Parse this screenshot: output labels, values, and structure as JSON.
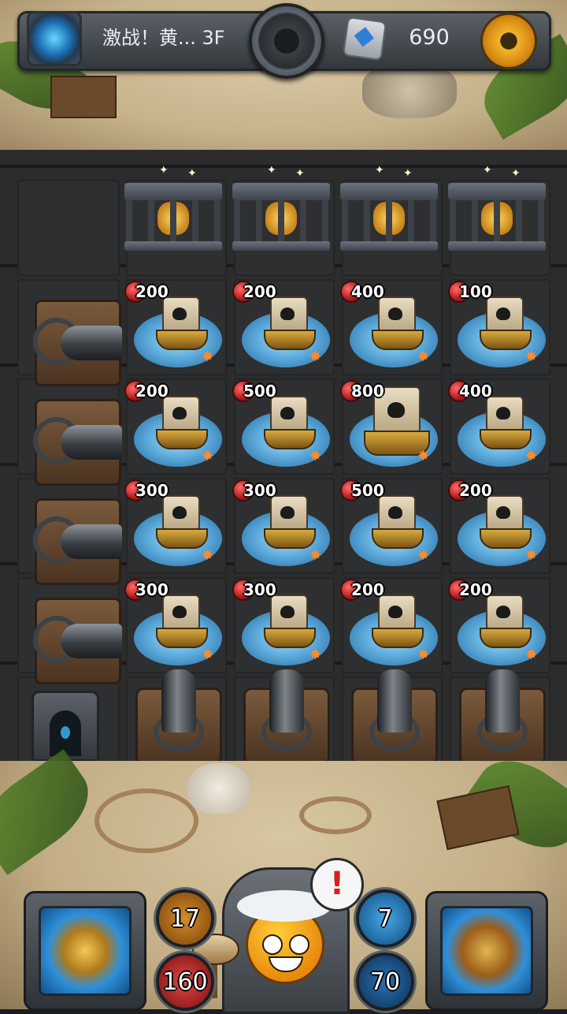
{
  "header": {
    "stage_title": "激战！黄... 3F",
    "gem_count": "690",
    "icons": [
      "portal-icon",
      "bomb-dial-icon",
      "gem-icon",
      "gear-icon"
    ]
  },
  "treasure_cages": [
    {
      "item": "gold-coins"
    },
    {
      "item": "gold-nuggets"
    },
    {
      "item": "gold-pot"
    },
    {
      "item": "jewelry"
    }
  ],
  "enemies": [
    [
      {
        "hp": "200"
      },
      {
        "hp": "200"
      },
      {
        "hp": "400"
      },
      {
        "hp": "100"
      }
    ],
    [
      {
        "hp": "200"
      },
      {
        "hp": "500"
      },
      {
        "hp": "800",
        "big": true
      },
      {
        "hp": "400"
      }
    ],
    [
      {
        "hp": "300"
      },
      {
        "hp": "300"
      },
      {
        "hp": "500"
      },
      {
        "hp": "200"
      }
    ],
    [
      {
        "hp": "300"
      },
      {
        "hp": "300"
      },
      {
        "hp": "200"
      },
      {
        "hp": "200"
      }
    ]
  ],
  "hud": {
    "attack": "17",
    "hp": "160",
    "mana": "7",
    "defense": "70",
    "alert": "!",
    "buttons": [
      "equipment-button",
      "spellbook-button"
    ]
  },
  "colors": {
    "hp_badge": "#b01818",
    "water": "#63b4e6",
    "sand": "#c6b28a",
    "board": "#2a2a2a"
  }
}
